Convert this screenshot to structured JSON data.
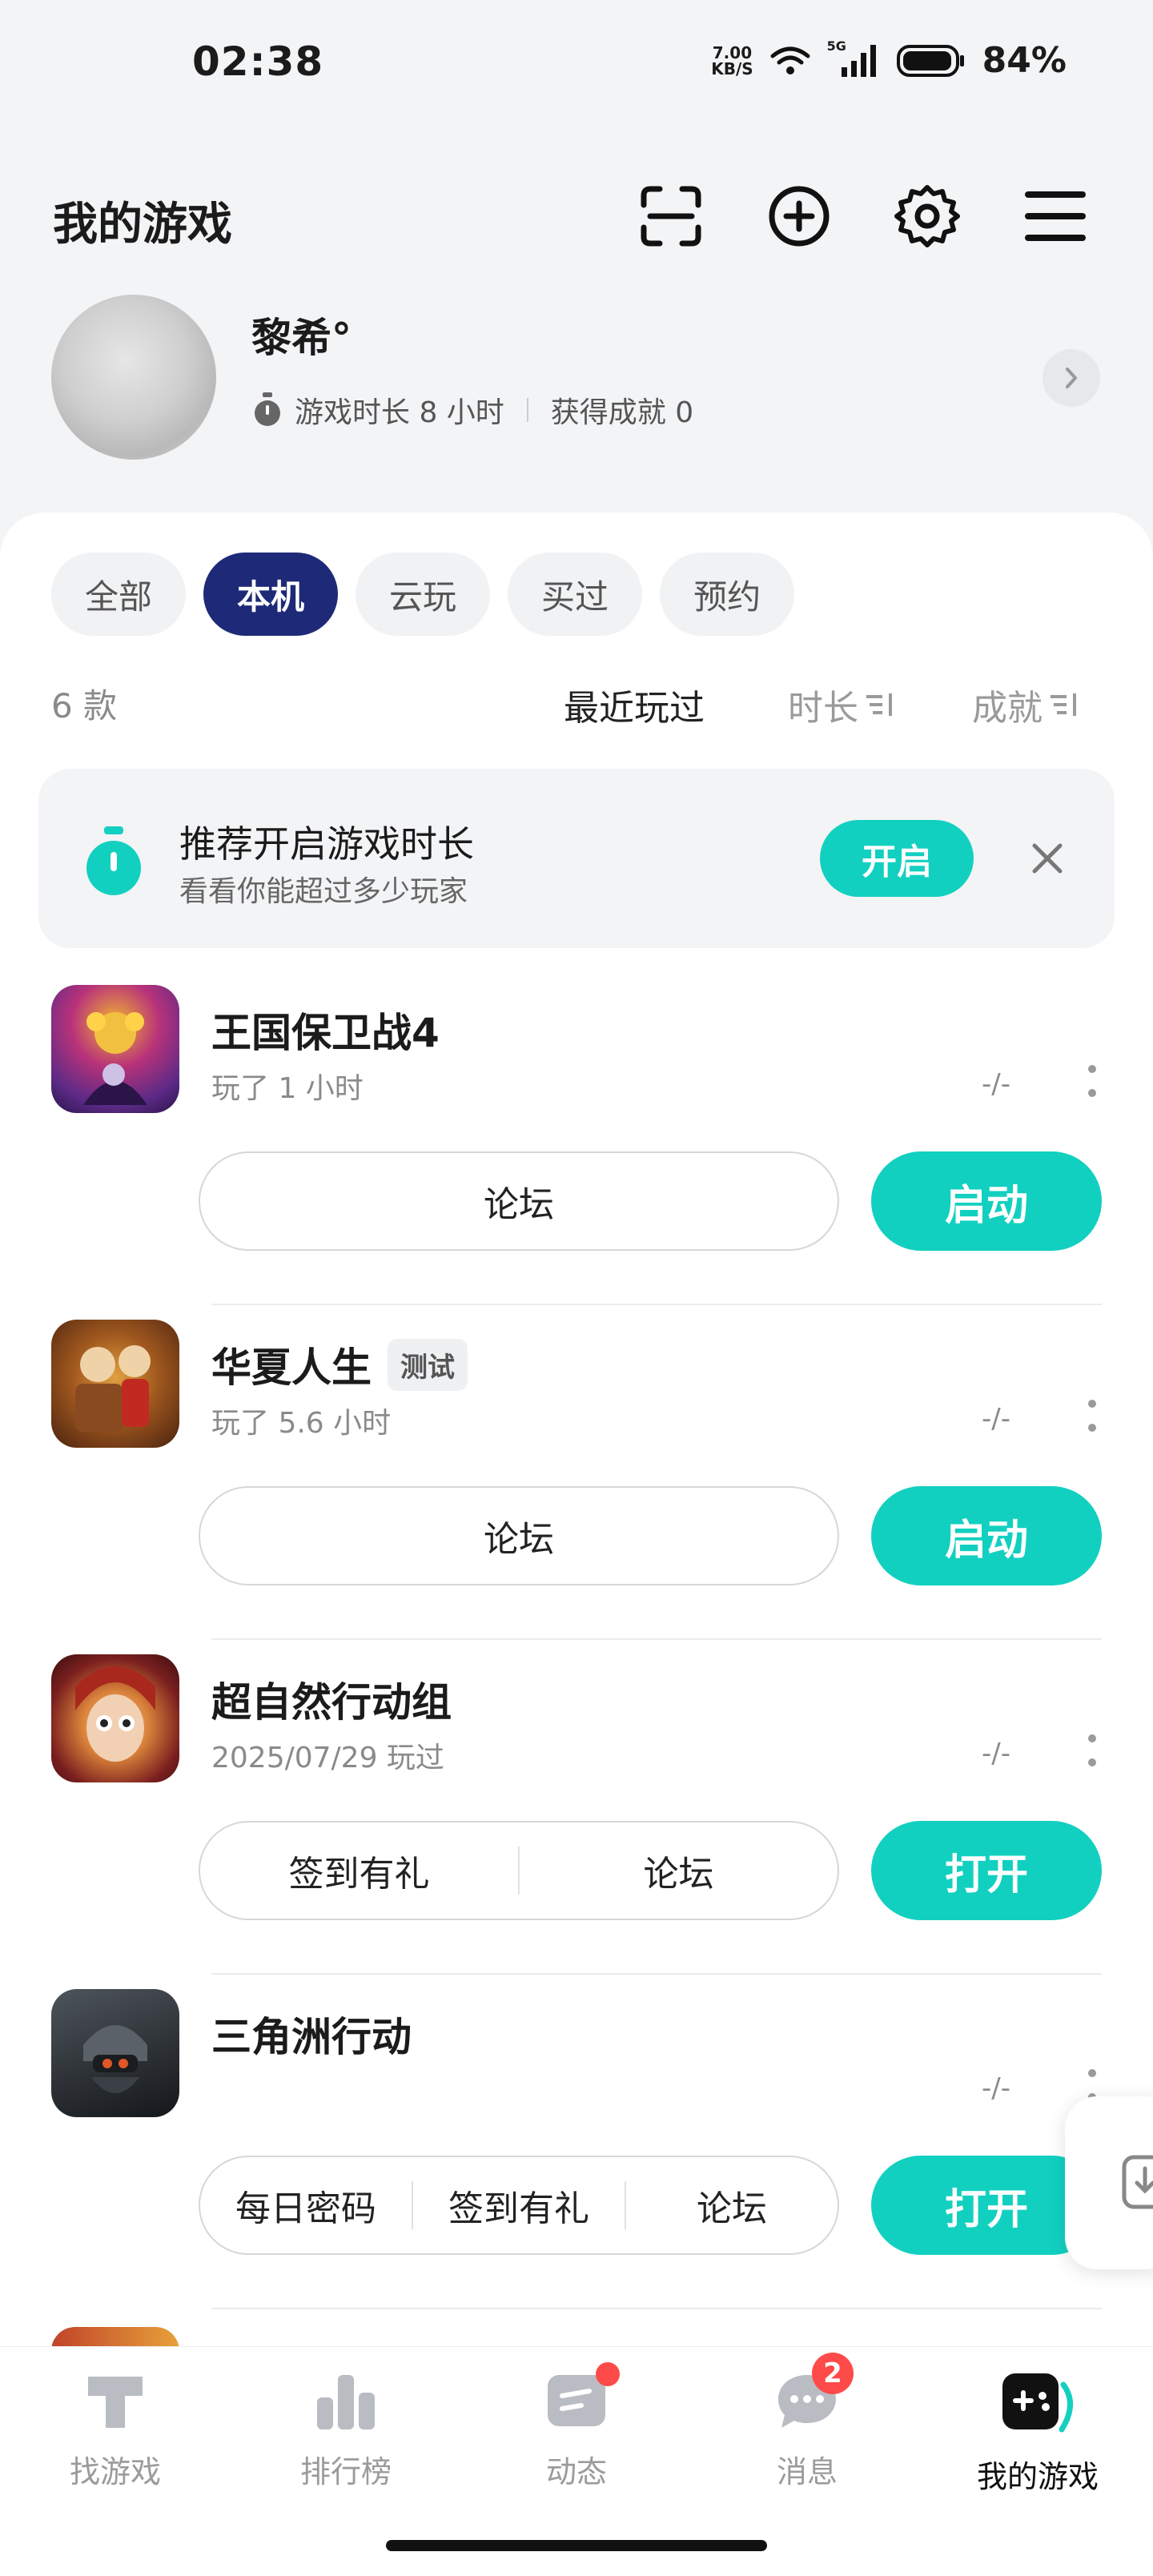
{
  "status_bar": {
    "time": "02:38",
    "net_speed_value": "7.00",
    "net_speed_unit": "KB/S",
    "network": "5G",
    "battery": "84%"
  },
  "header": {
    "title": "我的游戏",
    "icons": [
      "scan-icon",
      "add-circle-icon",
      "gear-icon",
      "menu-icon"
    ]
  },
  "profile": {
    "name": "黎希°",
    "play_time": "游戏时长 8 小时",
    "achievements": "获得成就 0"
  },
  "tabs": [
    {
      "label": "全部",
      "active": false
    },
    {
      "label": "本机",
      "active": true
    },
    {
      "label": "云玩",
      "active": false
    },
    {
      "label": "买过",
      "active": false
    },
    {
      "label": "预约",
      "active": false
    }
  ],
  "list_header": {
    "count": "6 款",
    "sort_recent": "最近玩过",
    "sort_duration": "时长",
    "sort_achievement": "成就"
  },
  "banner": {
    "title": "推荐开启游戏时长",
    "subtitle": "看看你能超过多少玩家",
    "button": "开启"
  },
  "games": [
    {
      "name": "王国保卫战4",
      "tag": "",
      "sub": "玩了 1 小时",
      "dash": "-/-",
      "actions": [
        "论坛"
      ],
      "primary": "启动",
      "icon_colors": [
        "#5b2a86",
        "#f2b530"
      ]
    },
    {
      "name": "华夏人生",
      "tag": "测试",
      "sub": "玩了 5.6 小时",
      "dash": "-/-",
      "actions": [
        "论坛"
      ],
      "primary": "启动",
      "icon_colors": [
        "#6b3a1a",
        "#e0a040"
      ]
    },
    {
      "name": "超自然行动组",
      "tag": "",
      "sub": "2025/07/29 玩过",
      "dash": "-/-",
      "actions": [
        "签到有礼",
        "论坛"
      ],
      "primary": "打开",
      "icon_colors": [
        "#7a1f1f",
        "#d9823a"
      ]
    },
    {
      "name": "三角洲行动",
      "tag": "",
      "sub": "",
      "dash": "-/-",
      "actions": [
        "每日密码",
        "签到有礼",
        "论坛"
      ],
      "primary": "打开",
      "icon_colors": [
        "#2b2f33",
        "#7f8a94"
      ]
    }
  ],
  "bottom_nav": [
    {
      "label": "找游戏",
      "icon": "find-game-icon",
      "active": false
    },
    {
      "label": "排行榜",
      "icon": "ranking-icon",
      "active": false
    },
    {
      "label": "动态",
      "icon": "feed-icon",
      "active": false,
      "dot": true
    },
    {
      "label": "消息",
      "icon": "message-icon",
      "active": false,
      "badge": "2"
    },
    {
      "label": "我的游戏",
      "icon": "my-games-icon",
      "active": true
    }
  ],
  "colors": {
    "accent": "#12d0c0",
    "tab_active": "#1e2a78",
    "badge": "#ff4a4a"
  }
}
